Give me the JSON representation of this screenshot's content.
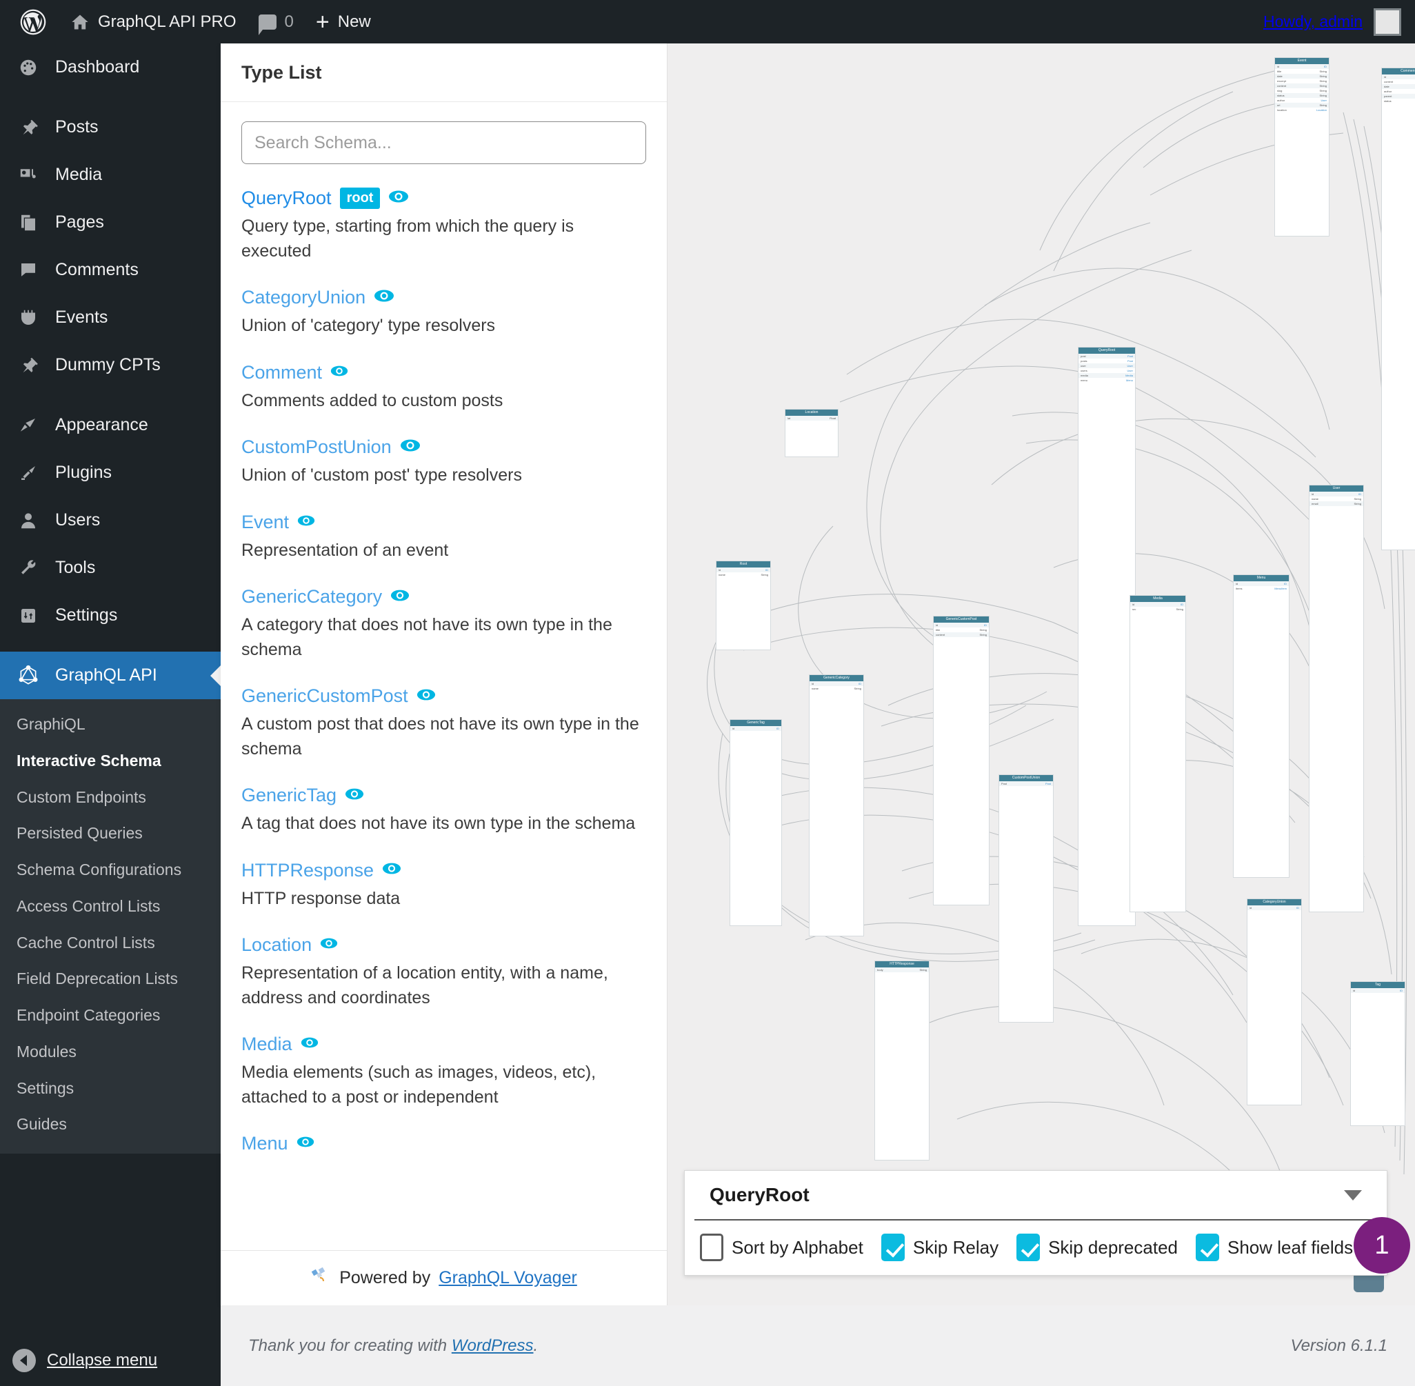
{
  "adminbar": {
    "logo_icon": "wordpress-logo-icon",
    "home_icon": "home-icon",
    "site_title": "GraphQL API PRO",
    "comments_icon": "comment-bubble-icon",
    "comments_count": "0",
    "new_icon": "plus-icon",
    "new_label": "New",
    "howdy": "Howdy, admin",
    "avatar": "avatar"
  },
  "sidebar": {
    "items": [
      {
        "label": "Dashboard",
        "icon": "dashboard-icon"
      },
      {
        "label": "Posts",
        "icon": "pin-icon"
      },
      {
        "label": "Media",
        "icon": "media-icon"
      },
      {
        "label": "Pages",
        "icon": "pages-icon"
      },
      {
        "label": "Comments",
        "icon": "comment-icon"
      },
      {
        "label": "Events",
        "icon": "calendar-icon"
      },
      {
        "label": "Dummy CPTs",
        "icon": "pin-icon"
      },
      {
        "label": "Appearance",
        "icon": "brush-icon"
      },
      {
        "label": "Plugins",
        "icon": "plug-icon"
      },
      {
        "label": "Users",
        "icon": "user-icon"
      },
      {
        "label": "Tools",
        "icon": "wrench-icon"
      },
      {
        "label": "Settings",
        "icon": "settings-icon"
      },
      {
        "label": "GraphQL API",
        "icon": "graphql-icon",
        "current": true
      }
    ],
    "submenu": [
      {
        "label": "GraphiQL"
      },
      {
        "label": "Interactive Schema",
        "current": true
      },
      {
        "label": "Custom Endpoints"
      },
      {
        "label": "Persisted Queries"
      },
      {
        "label": "Schema Configurations"
      },
      {
        "label": "Access Control Lists"
      },
      {
        "label": "Cache Control Lists"
      },
      {
        "label": "Field Deprecation Lists"
      },
      {
        "label": "Endpoint Categories"
      },
      {
        "label": "Modules"
      },
      {
        "label": "Settings"
      },
      {
        "label": "Guides"
      }
    ],
    "collapse_label": "Collapse menu",
    "collapse_icon": "collapse-arrow-icon"
  },
  "typelist": {
    "title": "Type List",
    "search_placeholder": "Search Schema...",
    "search_value": "",
    "eye_icon": "eye-icon",
    "root_badge": "root",
    "types": [
      {
        "name": "QueryRoot",
        "badge": "root",
        "desc": "Query type, starting from which the query is executed"
      },
      {
        "name": "CategoryUnion",
        "desc": "Union of 'category' type resolvers"
      },
      {
        "name": "Comment",
        "desc": "Comments added to custom posts"
      },
      {
        "name": "CustomPostUnion",
        "desc": "Union of 'custom post' type resolvers"
      },
      {
        "name": "Event",
        "desc": "Representation of an event"
      },
      {
        "name": "GenericCategory",
        "desc": "A category that does not have its own type in the schema"
      },
      {
        "name": "GenericCustomPost",
        "desc": "A custom post that does not have its own type in the schema"
      },
      {
        "name": "GenericTag",
        "desc": "A tag that does not have its own type in the schema"
      },
      {
        "name": "HTTPResponse",
        "desc": "HTTP response data"
      },
      {
        "name": "Location",
        "desc": "Representation of a location entity, with a name, address and coordinates"
      },
      {
        "name": "Media",
        "desc": "Media elements (such as images, videos, etc), attached to a post or independent"
      },
      {
        "name": "Menu",
        "desc": ""
      }
    ],
    "footer": {
      "icon": "voyager-satellite-icon",
      "prefix": "Powered by",
      "link": "GraphQL Voyager"
    }
  },
  "controls": {
    "root_type": "QueryRoot",
    "caret_icon": "chevron-down-icon",
    "options": [
      {
        "label": "Sort by Alphabet",
        "checked": false
      },
      {
        "label": "Skip Relay",
        "checked": true
      },
      {
        "label": "Skip deprecated",
        "checked": true
      },
      {
        "label": "Show leaf fields",
        "checked": true
      }
    ],
    "badge_count": "1"
  },
  "colors": {
    "wp_blue": "#2271b1",
    "voyager_cyan": "#00b6e3",
    "type_link": "#1f8ce6",
    "node_header": "#3f7f94",
    "badge_purple": "#7b1f7e",
    "graph_bg": "#efeeee"
  },
  "footer": {
    "thanks_prefix": "Thank you for creating with",
    "thanks_link": "WordPress",
    "thanks_suffix": ".",
    "version": "Version 6.1.1"
  }
}
